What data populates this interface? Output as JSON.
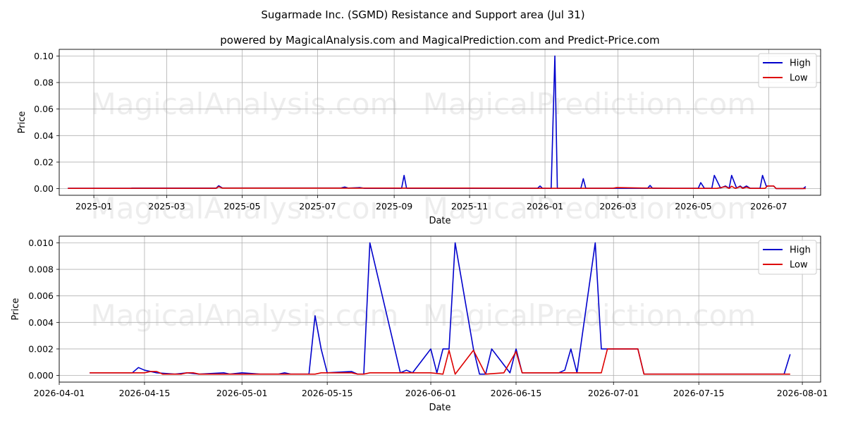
{
  "title": "Sugarmade Inc. (SGMD) Resistance and Support area (Jul 31)",
  "subtitle": "powered by MagicalAnalysis.com and MagicalPrediction.com and Predict-Price.com",
  "watermarks": [
    "MagicalAnalysis.com",
    "MagicalPrediction.com"
  ],
  "colors": {
    "high": "#0000cc",
    "low": "#dd0000",
    "grid": "#b0b0b0"
  },
  "chart_data": [
    {
      "type": "line",
      "xlabel": "Date",
      "ylabel": "Price",
      "xlim": [
        "2024-12-04",
        "2026-08-12"
      ],
      "ylim": [
        -0.005,
        0.105
      ],
      "x_ticks": [
        "2025-01",
        "2025-03",
        "2025-05",
        "2025-07",
        "2025-09",
        "2025-11",
        "2026-01",
        "2026-03",
        "2026-05",
        "2026-07"
      ],
      "x_tick_dates": [
        "2025-01-01",
        "2025-03-01",
        "2025-05-01",
        "2025-07-01",
        "2025-09-01",
        "2025-11-01",
        "2026-01-01",
        "2026-03-01",
        "2026-05-01",
        "2026-07-01"
      ],
      "y_ticks": [
        "0.00",
        "0.02",
        "0.04",
        "0.06",
        "0.08",
        "0.10"
      ],
      "y_tick_values": [
        0,
        0.02,
        0.04,
        0.06,
        0.08,
        0.1
      ],
      "grid": true,
      "legend_position": "upper-right",
      "series": [
        {
          "name": "High",
          "points": [
            [
              "2024-12-11",
              0.0003
            ],
            [
              "2025-01-31",
              0.0003
            ],
            [
              "2025-02-01",
              0.0004
            ],
            [
              "2025-04-10",
              0.0004
            ],
            [
              "2025-04-12",
              0.0022
            ],
            [
              "2025-04-15",
              0.0005
            ],
            [
              "2025-07-20",
              0.0005
            ],
            [
              "2025-07-23",
              0.0012
            ],
            [
              "2025-07-26",
              0.0004
            ],
            [
              "2025-08-04",
              0.0008
            ],
            [
              "2025-08-08",
              0.0003
            ],
            [
              "2025-09-07",
              0.0003
            ],
            [
              "2025-09-09",
              0.01
            ],
            [
              "2025-09-11",
              0.0003
            ],
            [
              "2025-12-26",
              0.0003
            ],
            [
              "2025-12-28",
              0.002
            ],
            [
              "2025-12-30",
              0.0002
            ],
            [
              "2026-01-06",
              0.0002
            ],
            [
              "2026-01-09",
              0.1
            ],
            [
              "2026-01-11",
              0.0002
            ],
            [
              "2026-01-30",
              0.0002
            ],
            [
              "2026-02-01",
              0.0075
            ],
            [
              "2026-02-03",
              0.0003
            ],
            [
              "2026-03-25",
              0.0003
            ],
            [
              "2026-03-27",
              0.0024
            ],
            [
              "2026-03-29",
              0.0003
            ],
            [
              "2026-05-05",
              0.0003
            ],
            [
              "2026-05-07",
              0.0045
            ],
            [
              "2026-05-10",
              0.0003
            ],
            [
              "2026-05-16",
              0.0003
            ],
            [
              "2026-05-18",
              0.01
            ],
            [
              "2026-05-23",
              0.0005
            ],
            [
              "2026-05-27",
              0.002
            ],
            [
              "2026-05-30",
              0.0003
            ],
            [
              "2026-06-01",
              0.01
            ],
            [
              "2026-06-05",
              0.0005
            ],
            [
              "2026-06-08",
              0.002
            ],
            [
              "2026-06-10",
              0.0005
            ],
            [
              "2026-06-13",
              0.002
            ],
            [
              "2026-06-16",
              0.0003
            ],
            [
              "2026-06-24",
              0.0003
            ],
            [
              "2026-06-26",
              0.01
            ],
            [
              "2026-06-29",
              0.002
            ],
            [
              "2026-07-05",
              0.002
            ],
            [
              "2026-07-07",
              0.0001
            ],
            [
              "2026-07-29",
              0.0001
            ],
            [
              "2026-07-31",
              0.0016
            ]
          ]
        },
        {
          "name": "Low",
          "points": [
            [
              "2024-12-11",
              0.0002
            ],
            [
              "2025-01-31",
              0.0002
            ],
            [
              "2025-02-01",
              0.0003
            ],
            [
              "2025-04-10",
              0.0003
            ],
            [
              "2025-04-12",
              0.0015
            ],
            [
              "2025-04-15",
              0.0004
            ],
            [
              "2025-11-01",
              0.0004
            ],
            [
              "2025-12-26",
              0.0003
            ],
            [
              "2026-02-25",
              0.0003
            ],
            [
              "2026-02-28",
              0.0008
            ],
            [
              "2026-03-20",
              0.0005
            ],
            [
              "2026-04-15",
              0.0002
            ],
            [
              "2026-05-20",
              0.0002
            ],
            [
              "2026-05-27",
              0.0015
            ],
            [
              "2026-05-30",
              0.0002
            ],
            [
              "2026-06-01",
              0.0018
            ],
            [
              "2026-06-04",
              0.0002
            ],
            [
              "2026-06-08",
              0.0015
            ],
            [
              "2026-06-10",
              0.0002
            ],
            [
              "2026-06-13",
              0.0012
            ],
            [
              "2026-06-16",
              0.0002
            ],
            [
              "2026-06-28",
              0.0002
            ],
            [
              "2026-06-30",
              0.002
            ],
            [
              "2026-07-05",
              0.002
            ],
            [
              "2026-07-07",
              0.0001
            ],
            [
              "2026-07-31",
              0.0001
            ]
          ]
        }
      ]
    },
    {
      "type": "line",
      "xlabel": "Date",
      "ylabel": "Price",
      "xlim": [
        "2026-04-01",
        "2026-08-04"
      ],
      "ylim": [
        -0.0005,
        0.0105
      ],
      "x_ticks": [
        "2026-04-01",
        "2026-04-15",
        "2026-05-01",
        "2026-05-15",
        "2026-06-01",
        "2026-06-15",
        "2026-07-01",
        "2026-07-15",
        "2026-08-01"
      ],
      "x_tick_dates": [
        "2026-04-01",
        "2026-04-15",
        "2026-05-01",
        "2026-05-15",
        "2026-06-01",
        "2026-06-15",
        "2026-07-01",
        "2026-07-15",
        "2026-08-01"
      ],
      "y_ticks": [
        "0.000",
        "0.002",
        "0.004",
        "0.006",
        "0.008",
        "0.010"
      ],
      "y_tick_values": [
        0,
        0.002,
        0.004,
        0.006,
        0.008,
        0.01
      ],
      "grid": true,
      "legend_position": "upper-right",
      "series": [
        {
          "name": "High",
          "points": [
            [
              "2026-04-06",
              0.0002
            ],
            [
              "2026-04-13",
              0.0002
            ],
            [
              "2026-04-14",
              0.0006
            ],
            [
              "2026-04-15",
              0.0004
            ],
            [
              "2026-04-16",
              0.0003
            ],
            [
              "2026-04-17",
              0.0002
            ],
            [
              "2026-04-20",
              0.0001
            ],
            [
              "2026-04-22",
              0.0002
            ],
            [
              "2026-04-24",
              0.0001
            ],
            [
              "2026-04-28",
              0.0002
            ],
            [
              "2026-04-29",
              0.0001
            ],
            [
              "2026-05-01",
              0.0002
            ],
            [
              "2026-05-04",
              0.0001
            ],
            [
              "2026-05-07",
              0.0001
            ],
            [
              "2026-05-08",
              0.0002
            ],
            [
              "2026-05-09",
              0.0001
            ],
            [
              "2026-05-11",
              0.0001
            ],
            [
              "2026-05-12",
              0.0001
            ],
            [
              "2026-05-13",
              0.0045
            ],
            [
              "2026-05-14",
              0.002
            ],
            [
              "2026-05-15",
              0.0002
            ],
            [
              "2026-05-19",
              0.0003
            ],
            [
              "2026-05-20",
              0.0001
            ],
            [
              "2026-05-21",
              0.0001
            ],
            [
              "2026-05-22",
              0.01
            ],
            [
              "2026-05-27",
              0.0002
            ],
            [
              "2026-05-28",
              0.0004
            ],
            [
              "2026-05-29",
              0.0002
            ],
            [
              "2026-06-01",
              0.002
            ],
            [
              "2026-06-02",
              0.0002
            ],
            [
              "2026-06-03",
              0.002
            ],
            [
              "2026-06-04",
              0.002
            ],
            [
              "2026-06-05",
              0.01
            ],
            [
              "2026-06-08",
              0.002
            ],
            [
              "2026-06-09",
              0.0001
            ],
            [
              "2026-06-10",
              0.0001
            ],
            [
              "2026-06-11",
              0.002
            ],
            [
              "2026-06-14",
              0.0002
            ],
            [
              "2026-06-15",
              0.002
            ],
            [
              "2026-06-16",
              0.0002
            ],
            [
              "2026-06-22",
              0.0002
            ],
            [
              "2026-06-23",
              0.0004
            ],
            [
              "2026-06-24",
              0.002
            ],
            [
              "2026-06-25",
              0.0002
            ],
            [
              "2026-06-28",
              0.01
            ],
            [
              "2026-06-29",
              0.002
            ],
            [
              "2026-07-05",
              0.002
            ],
            [
              "2026-07-06",
              0.0001
            ],
            [
              "2026-07-29",
              0.0001
            ],
            [
              "2026-07-30",
              0.0016
            ]
          ]
        },
        {
          "name": "Low",
          "points": [
            [
              "2026-04-06",
              0.0002
            ],
            [
              "2026-04-15",
              0.0002
            ],
            [
              "2026-04-16",
              0.0003
            ],
            [
              "2026-04-17",
              0.0003
            ],
            [
              "2026-04-18",
              0.0001
            ],
            [
              "2026-04-21",
              0.0001
            ],
            [
              "2026-04-22",
              0.0002
            ],
            [
              "2026-04-23",
              0.0002
            ],
            [
              "2026-04-24",
              0.0001
            ],
            [
              "2026-05-12",
              0.0001
            ],
            [
              "2026-05-13",
              0.0001
            ],
            [
              "2026-05-14",
              0.0002
            ],
            [
              "2026-05-19",
              0.0002
            ],
            [
              "2026-05-20",
              0.0001
            ],
            [
              "2026-05-21",
              0.0001
            ],
            [
              "2026-05-22",
              0.0002
            ],
            [
              "2026-06-01",
              0.0002
            ],
            [
              "2026-06-03",
              0.0001
            ],
            [
              "2026-06-04",
              0.0019
            ],
            [
              "2026-06-05",
              0.0001
            ],
            [
              "2026-06-08",
              0.0019
            ],
            [
              "2026-06-10",
              0.0001
            ],
            [
              "2026-06-13",
              0.0002
            ],
            [
              "2026-06-15",
              0.0018
            ],
            [
              "2026-06-16",
              0.0002
            ],
            [
              "2026-06-29",
              0.0002
            ],
            [
              "2026-06-30",
              0.002
            ],
            [
              "2026-07-05",
              0.002
            ],
            [
              "2026-07-06",
              0.0001
            ],
            [
              "2026-07-30",
              0.0001
            ]
          ]
        }
      ]
    }
  ]
}
